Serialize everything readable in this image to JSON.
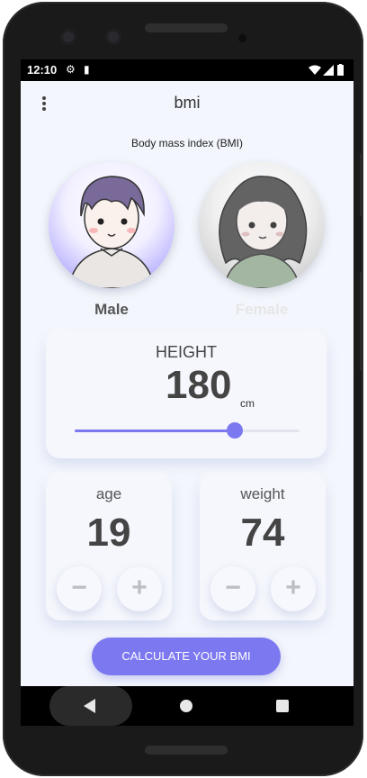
{
  "status_bar": {
    "time": "12:10"
  },
  "app_bar": {
    "title": "bmi"
  },
  "subtitle": "Body mass index (BMI)",
  "gender": {
    "male_label": "Male",
    "female_label": "Female",
    "selected": "Male",
    "male_color": "#555555",
    "female_color": "#e6e6e6"
  },
  "height": {
    "label": "HEIGHT",
    "value": "180",
    "unit": "cm",
    "slider_fraction": 0.71
  },
  "age": {
    "label": "age",
    "value": "19",
    "minus": "−",
    "plus": "+"
  },
  "weight": {
    "label": "weight",
    "value": "74",
    "minus": "−",
    "plus": "+"
  },
  "calculate_button": "CALCULATE YOUR BMI",
  "colors": {
    "accent": "#7c78f0",
    "background": "#f3f6fc"
  }
}
